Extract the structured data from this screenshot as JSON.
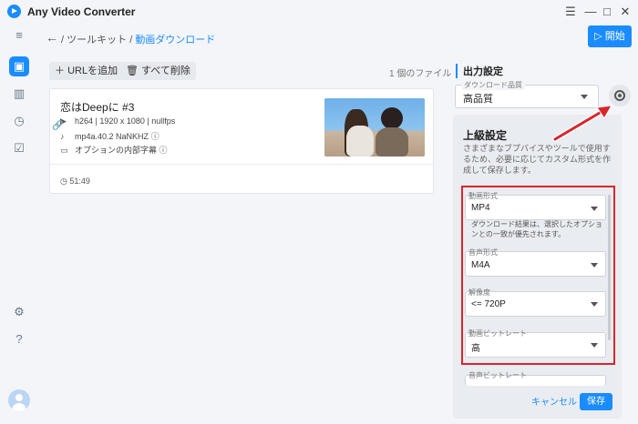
{
  "app": {
    "title": "Any Video Converter"
  },
  "window_controls": {
    "menu": "☰",
    "minimize": "—",
    "maximize": "□",
    "close": "✕"
  },
  "breadcrumb": {
    "back": "←",
    "parent": "ツールキット",
    "separator": "/",
    "current": "動画ダウンロード"
  },
  "header": {
    "start_label": "開始",
    "start_icon": "▷"
  },
  "toolbar": {
    "add_url_label": "URLを追加",
    "delete_all_label": "すべて削除",
    "file_count": "1 個のファイル"
  },
  "file": {
    "title": "恋はDeepに #3",
    "video_info": "h264 | 1920 x 1080 | nullfps",
    "audio_info": "mp4a.40.2  NaNKHZ",
    "subtitle_info": "オプションの内部字幕",
    "duration": "51:49"
  },
  "output": {
    "section_title": "出力設定",
    "quality_label": "ダウンロード品質",
    "quality_value": "高品質"
  },
  "advanced": {
    "title": "上級設定",
    "description": "さまざまなブプバイスやツールで使用するため、必要に応じてカスタム形式を作成して保存します。",
    "video_format_label": "動画形式",
    "video_format_value": "MP4",
    "note": "ダウンロード結果は、選択したオプションとの一致が優先されます。",
    "audio_format_label": "音声形式",
    "audio_format_value": "M4A",
    "resolution_label": "解像度",
    "resolution_value": "<= 720P",
    "video_bitrate_label": "動画ビットレート",
    "video_bitrate_value": "高",
    "audio_bitrate_label": "音声ビットレート",
    "cancel_label": "キャンセル",
    "save_label": "保存"
  },
  "colors": {
    "accent": "#1a8cff",
    "highlight": "#d9262c"
  }
}
